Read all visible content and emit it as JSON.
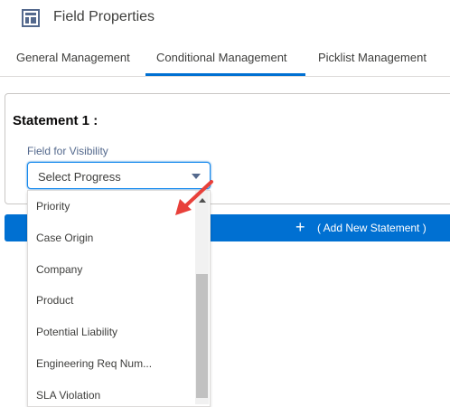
{
  "header": {
    "title": "Field Properties",
    "icon": "layout-icon"
  },
  "tabs": [
    {
      "label": "General Management",
      "active": false
    },
    {
      "label": "Conditional Management",
      "active": true
    },
    {
      "label": "Picklist Management",
      "active": false
    }
  ],
  "statement": {
    "title": "Statement 1 :",
    "field_label": "Field for Visibility",
    "select_value": "Select Progress"
  },
  "add_statement": {
    "label": "( Add New Statement )"
  },
  "dropdown": {
    "options": [
      "Priority",
      "Case Origin",
      "Company",
      "Product",
      "Potential Liability",
      "Engineering Req Num...",
      "SLA Violation"
    ]
  },
  "colors": {
    "accent": "#0070d2",
    "annotation_arrow": "#e8403a"
  }
}
